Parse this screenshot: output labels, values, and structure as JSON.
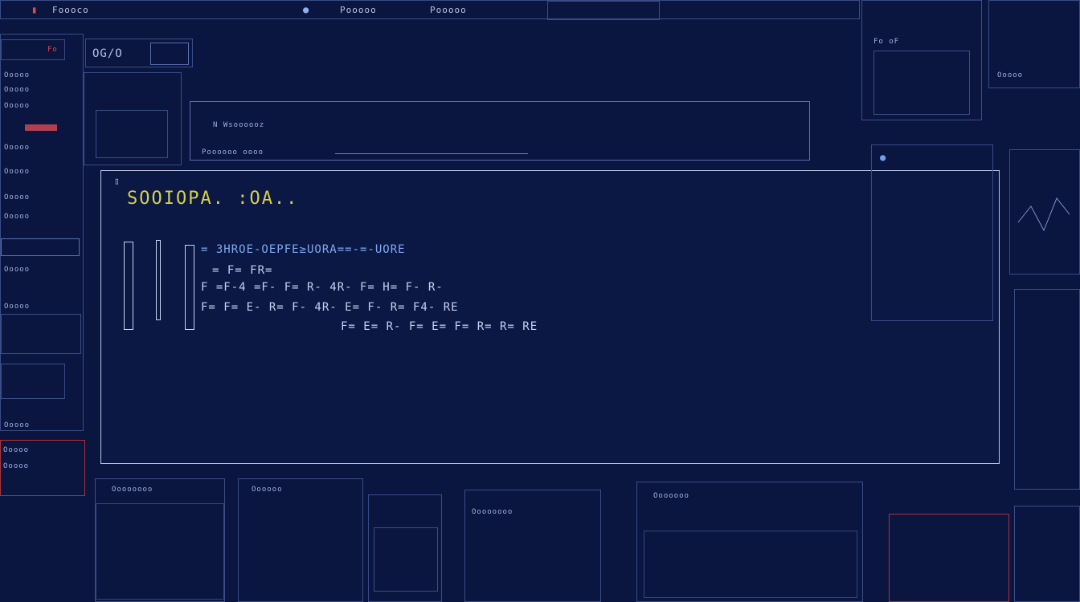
{
  "top_bar": {
    "left_label": "Foooco",
    "toolbar_label": "Pooooo",
    "toolbar_text": "Pooooo"
  },
  "left_panel": {
    "header": "Fo",
    "rows": [
      "Ooooo",
      "Ooooo",
      "Ooooo",
      "Ooooo",
      "Ooooo",
      "Ooooo",
      "Ooooo",
      "Ooooo",
      "Ooooo",
      "Ooooo",
      "Ooooo",
      "Ooooo"
    ]
  },
  "small_box": {
    "label": "OG/O"
  },
  "info_panel": {
    "line_1": "N Wsoooooz",
    "line_2": "Poooooo oooo"
  },
  "main_window": {
    "title": "SOOIOPA. :OA..",
    "line_1": "= 3HROE-OEPFE≥UORA==-=-UORE",
    "line_2": "= F= FR=",
    "line_3": "F =F-4 =F- F= R- 4R- F= H= F- R-",
    "line_4": "F= F= E- R= F- 4R- E= F- R= F4- RE",
    "line_5": "F= E= R- F= E= F= R= R= RE"
  },
  "right_panels": {
    "top_label": "Fo oF",
    "sub_label": "Ooooo"
  },
  "bottom_panels": {
    "panel_1_title": "Oooooooo",
    "panel_2_title": "Oooooo",
    "panel_3_title": "Oooooooo",
    "panel_4_title": "Ooooooo"
  },
  "colors": {
    "background": "#0b1640",
    "frame": "#3a4c86",
    "title": "#d6d04a",
    "highlight": "#7fa9f0",
    "alert": "#e04a4a"
  }
}
